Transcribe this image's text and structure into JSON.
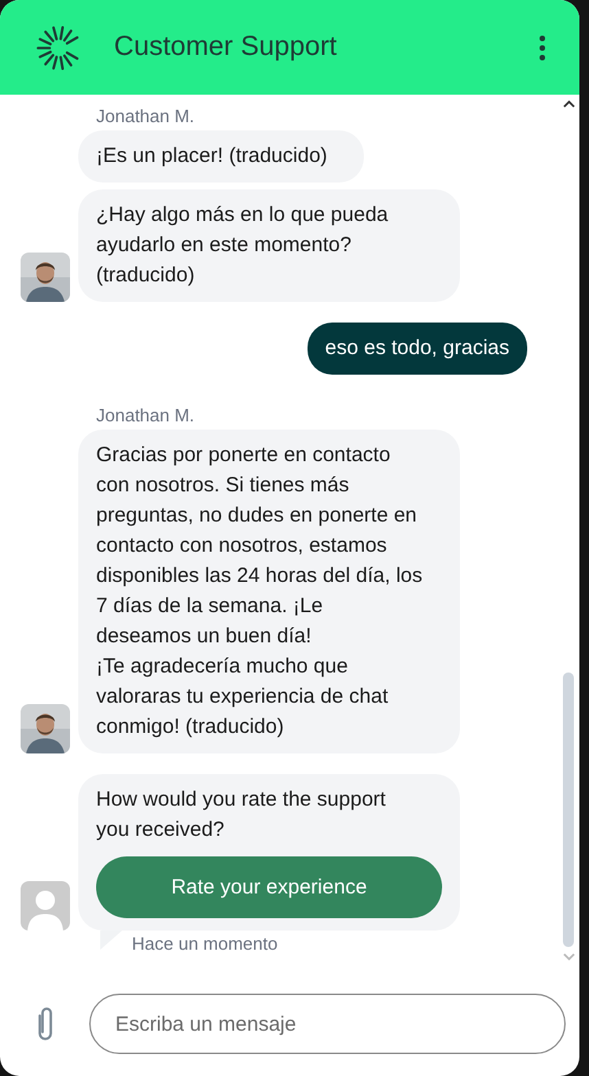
{
  "header": {
    "title": "Customer Support"
  },
  "messages": [
    {
      "kind": "agent",
      "sender": "Jonathan M.",
      "avatar": {
        "kind": "picture"
      },
      "bubbles": [
        [
          "¡Es un placer! (traducido)"
        ],
        [
          "¿Hay algo más en lo que pueda ayudarlo en este momento? (traducido)"
        ]
      ]
    },
    {
      "kind": "user",
      "bubbles": [
        [
          "eso es todo, gracias"
        ]
      ]
    },
    {
      "kind": "agent",
      "sender": "Jonathan M.",
      "avatar": {
        "kind": "picture"
      },
      "bubbles": [
        [
          "Gracias por ponerte en contacto con nosotros. Si tienes más preguntas, no dudes en ponerte en contacto con nosotros, estamos disponibles las 24 horas del día, los 7 días de la semana. ¡Le deseamos un buen día!",
          "¡Te agradecería mucho que valoraras tu experiencia de chat conmigo! (traducido)"
        ]
      ]
    },
    {
      "kind": "rating",
      "avatar": {
        "kind": "silhouette"
      },
      "text": "How would you rate the support you received?",
      "button": "Rate your experience",
      "time": "Hace un momento"
    }
  ],
  "composer": {
    "placeholder": "Escriba un mensaje"
  }
}
